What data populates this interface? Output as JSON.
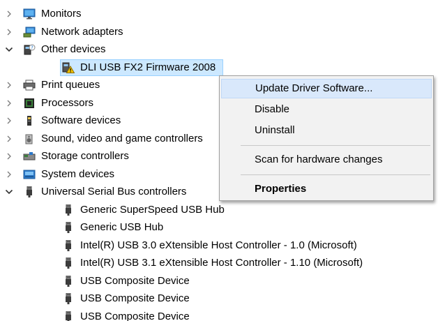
{
  "tree": {
    "items": [
      {
        "label": "Monitors",
        "icon": "monitor-icon",
        "expand": "collapsed",
        "indent": 0
      },
      {
        "label": "Network adapters",
        "icon": "network-adapter-icon",
        "expand": "collapsed",
        "indent": 0
      },
      {
        "label": "Other devices",
        "icon": "other-devices-icon",
        "expand": "expanded",
        "indent": 0
      },
      {
        "label": "DLI USB FX2 Firmware 2008",
        "icon": "warning-device-icon",
        "expand": "none",
        "indent": 1,
        "selected": true
      },
      {
        "label": "Print queues",
        "icon": "printer-icon",
        "expand": "collapsed",
        "indent": 0
      },
      {
        "label": "Processors",
        "icon": "processor-icon",
        "expand": "collapsed",
        "indent": 0
      },
      {
        "label": "Software devices",
        "icon": "software-device-icon",
        "expand": "collapsed",
        "indent": 0
      },
      {
        "label": "Sound, video and game controllers",
        "icon": "speaker-icon",
        "expand": "collapsed",
        "indent": 0
      },
      {
        "label": "Storage controllers",
        "icon": "storage-controller-icon",
        "expand": "collapsed",
        "indent": 0
      },
      {
        "label": "System devices",
        "icon": "system-devices-icon",
        "expand": "collapsed",
        "indent": 0
      },
      {
        "label": "Universal Serial Bus controllers",
        "icon": "usb-icon",
        "expand": "expanded",
        "indent": 0
      },
      {
        "label": "Generic SuperSpeed USB Hub",
        "icon": "usb-icon",
        "expand": "none",
        "indent": 1
      },
      {
        "label": "Generic USB Hub",
        "icon": "usb-icon",
        "expand": "none",
        "indent": 1
      },
      {
        "label": "Intel(R) USB 3.0 eXtensible Host Controller - 1.0 (Microsoft)",
        "icon": "usb-icon",
        "expand": "none",
        "indent": 1
      },
      {
        "label": "Intel(R) USB 3.1 eXtensible Host Controller - 1.10 (Microsoft)",
        "icon": "usb-icon",
        "expand": "none",
        "indent": 1
      },
      {
        "label": "USB Composite Device",
        "icon": "usb-icon",
        "expand": "none",
        "indent": 1
      },
      {
        "label": "USB Composite Device",
        "icon": "usb-icon",
        "expand": "none",
        "indent": 1
      },
      {
        "label": "USB Composite Device",
        "icon": "usb-icon",
        "expand": "none",
        "indent": 1
      }
    ]
  },
  "context_menu": {
    "items": [
      {
        "label": "Update Driver Software...",
        "bold": false,
        "highlighted": true
      },
      {
        "label": "Disable",
        "bold": false,
        "highlighted": false
      },
      {
        "label": "Uninstall",
        "bold": false,
        "highlighted": false
      },
      {
        "separator": true
      },
      {
        "label": "Scan for hardware changes",
        "bold": false,
        "highlighted": false
      },
      {
        "separator": true
      },
      {
        "label": "Properties",
        "bold": true,
        "highlighted": false
      }
    ]
  },
  "colors": {
    "selection": "#cce8ff",
    "menu_highlight": "#d9e8fb",
    "menu_background": "#f2f2f2"
  }
}
